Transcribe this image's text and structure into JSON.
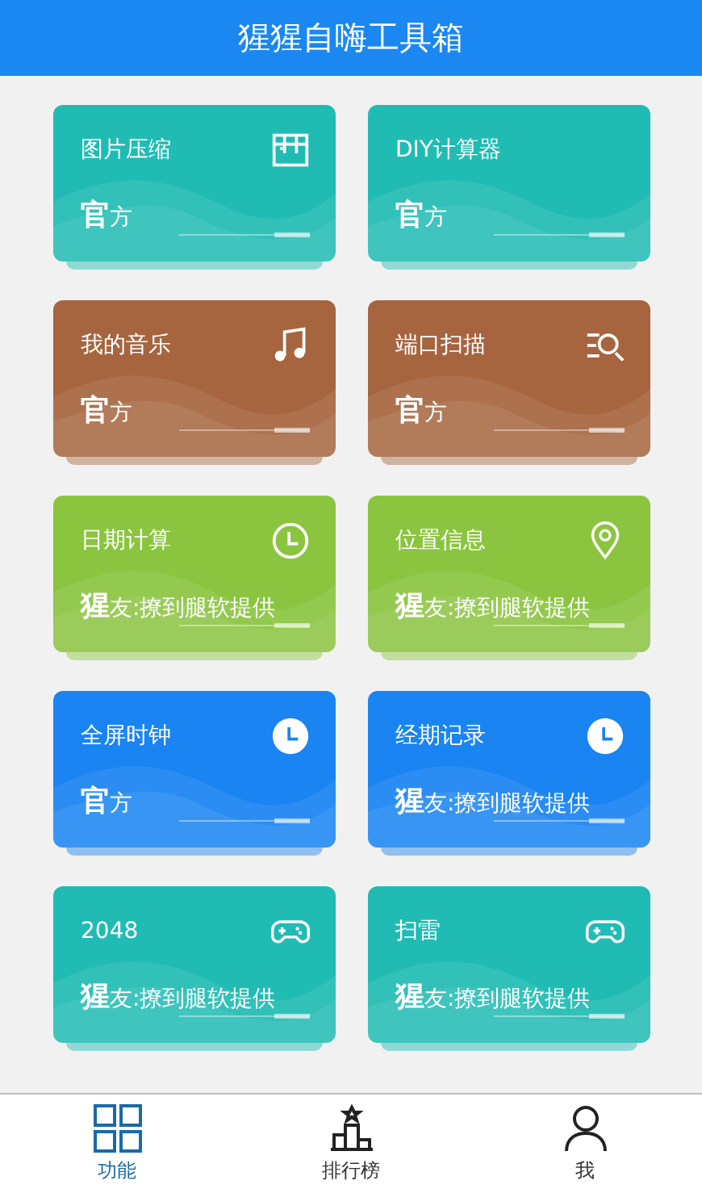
{
  "header": {
    "title": "猩猩自嗨工具箱"
  },
  "cards": [
    {
      "title": "图片压缩",
      "kind": "box",
      "badge": "官",
      "note": "方",
      "color": "#20bcb4"
    },
    {
      "title": "DIY计算器",
      "kind": "plain",
      "badge": "官",
      "note": "方",
      "color": "#20bcb4"
    },
    {
      "title": "我的音乐",
      "kind": "music",
      "badge": "官",
      "note": "方",
      "color": "#a6653f"
    },
    {
      "title": "端口扫描",
      "kind": "scan",
      "badge": "官",
      "note": "方",
      "color": "#a6653f"
    },
    {
      "title": "日期计算",
      "kind": "clock",
      "badge": "猩",
      "note": "友:撩到腿软提供",
      "color": "#8bc540"
    },
    {
      "title": "位置信息",
      "kind": "pin",
      "badge": "猩",
      "note": "友:撩到腿软提供",
      "color": "#8bc540"
    },
    {
      "title": "全屏时钟",
      "kind": "timer",
      "badge": "官",
      "note": "方",
      "color": "#1a84f2"
    },
    {
      "title": "经期记录",
      "kind": "timer",
      "badge": "猩",
      "note": "友:撩到腿软提供",
      "color": "#1a84f2"
    },
    {
      "title": "2048",
      "kind": "game",
      "badge": "猩",
      "note": "友:撩到腿软提供",
      "color": "#20bcb4"
    },
    {
      "title": "扫雷",
      "kind": "game",
      "badge": "猩",
      "note": "友:撩到腿软提供",
      "color": "#20bcb4"
    }
  ],
  "tabs": [
    {
      "label": "功能",
      "kind": "grid",
      "selected": true
    },
    {
      "label": "排行榜",
      "kind": "podium",
      "selected": false
    },
    {
      "label": "我",
      "kind": "person",
      "selected": false
    }
  ]
}
